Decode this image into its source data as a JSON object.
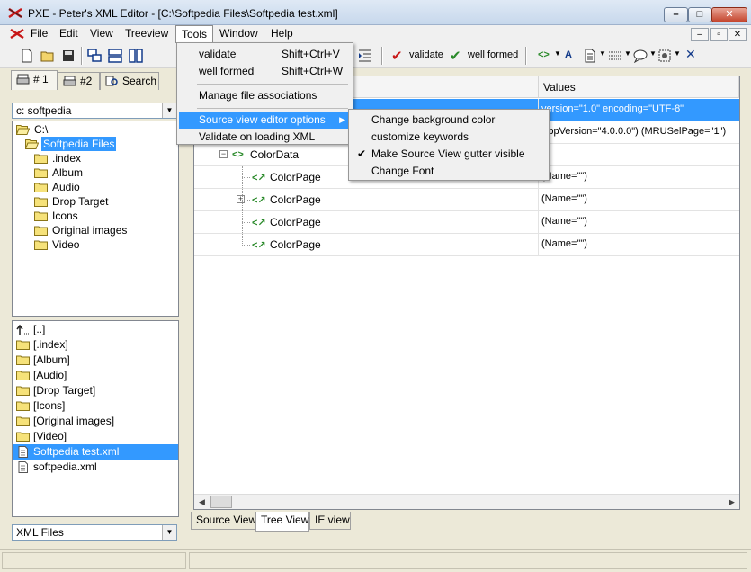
{
  "window": {
    "title": "PXE - Peter's XML Editor - [C:\\Softpedia Files\\Softpedia test.xml]",
    "minimize_label": "–",
    "maximize_label": "□",
    "close_label": "✕"
  },
  "menubar": {
    "items": [
      "File",
      "Edit",
      "View",
      "Treeview",
      "Tools",
      "Window",
      "Help"
    ],
    "active": "Tools",
    "mdi_buttons": [
      "–",
      "▫",
      "✕"
    ]
  },
  "toolbar": {
    "validate_label": "validate",
    "well_formed_label": "well formed"
  },
  "tools_menu": {
    "items": [
      {
        "label": "validate",
        "shortcut": "Shift+Ctrl+V"
      },
      {
        "label": "well formed",
        "shortcut": "Shift+Ctrl+W"
      },
      {
        "label": "Manage file associations"
      },
      {
        "label": "Source view editor options",
        "submenu_arrow": "▶"
      },
      {
        "label": "Validate on loading XML"
      }
    ],
    "highlighted": "Source view editor options"
  },
  "submenu": {
    "items": [
      {
        "label": "Change background color",
        "checked": false
      },
      {
        "label": "customize keywords",
        "checked": false
      },
      {
        "label": "Make Source View gutter visible",
        "checked": true
      },
      {
        "label": "Change Font",
        "checked": false
      }
    ],
    "check_mark": "✔"
  },
  "left_panel": {
    "tabs": [
      "# 1",
      "#2",
      "Search"
    ],
    "drive_combo": "c: softpedia",
    "dir_tree": [
      {
        "label": "C:\\",
        "level": 0,
        "selected": false
      },
      {
        "label": "Softpedia Files",
        "level": 1,
        "selected": true
      },
      {
        "label": ".index",
        "level": 2,
        "selected": false
      },
      {
        "label": "Album",
        "level": 2,
        "selected": false
      },
      {
        "label": "Audio",
        "level": 2,
        "selected": false
      },
      {
        "label": "Drop Target",
        "level": 2,
        "selected": false
      },
      {
        "label": "Icons",
        "level": 2,
        "selected": false
      },
      {
        "label": "Original images",
        "level": 2,
        "selected": false
      },
      {
        "label": "Video",
        "level": 2,
        "selected": false
      }
    ],
    "file_list": [
      {
        "label": "[..]",
        "kind": "up",
        "selected": false
      },
      {
        "label": "[.index]",
        "kind": "folder",
        "selected": false
      },
      {
        "label": "[Album]",
        "kind": "folder",
        "selected": false
      },
      {
        "label": "[Audio]",
        "kind": "folder",
        "selected": false
      },
      {
        "label": "[Drop Target]",
        "kind": "folder",
        "selected": false
      },
      {
        "label": "[Icons]",
        "kind": "folder",
        "selected": false
      },
      {
        "label": "[Original images]",
        "kind": "folder",
        "selected": false
      },
      {
        "label": "[Video]",
        "kind": "folder",
        "selected": false
      },
      {
        "label": "Softpedia test.xml",
        "kind": "xml",
        "selected": true
      },
      {
        "label": "softpedia.xml",
        "kind": "xml",
        "selected": false
      }
    ],
    "filter_combo": "XML Files"
  },
  "tree_view": {
    "values_header": "Values",
    "rows": [
      {
        "node": "",
        "value": "version=\"1.0\" encoding=\"UTF-8\"",
        "selected": true
      },
      {
        "node": "",
        "value": "AppVersion=\"4.0.0.0\") (MRUSelPage=\"1\")",
        "selected": false
      },
      {
        "node": "ColorData",
        "value": "",
        "selected": false,
        "expander": "−"
      },
      {
        "node": "ColorPage",
        "value": "(Name=\"\")",
        "selected": false
      },
      {
        "node": "ColorPage",
        "value": "(Name=\"\")",
        "selected": false,
        "expander": "+"
      },
      {
        "node": "ColorPage",
        "value": "(Name=\"\")",
        "selected": false
      },
      {
        "node": "ColorPage",
        "value": "(Name=\"\")",
        "selected": false
      }
    ],
    "node_icon_glyph": "<>",
    "child_icon_glyph": "<↗"
  },
  "bottom_tabs": [
    "Source View",
    "Tree View",
    "IE view"
  ],
  "active_bottom_tab": "Tree View",
  "colors": {
    "selection": "#3399ff",
    "menu_bg": "#f0f0f0",
    "panel_bg": "#ece9d8"
  }
}
